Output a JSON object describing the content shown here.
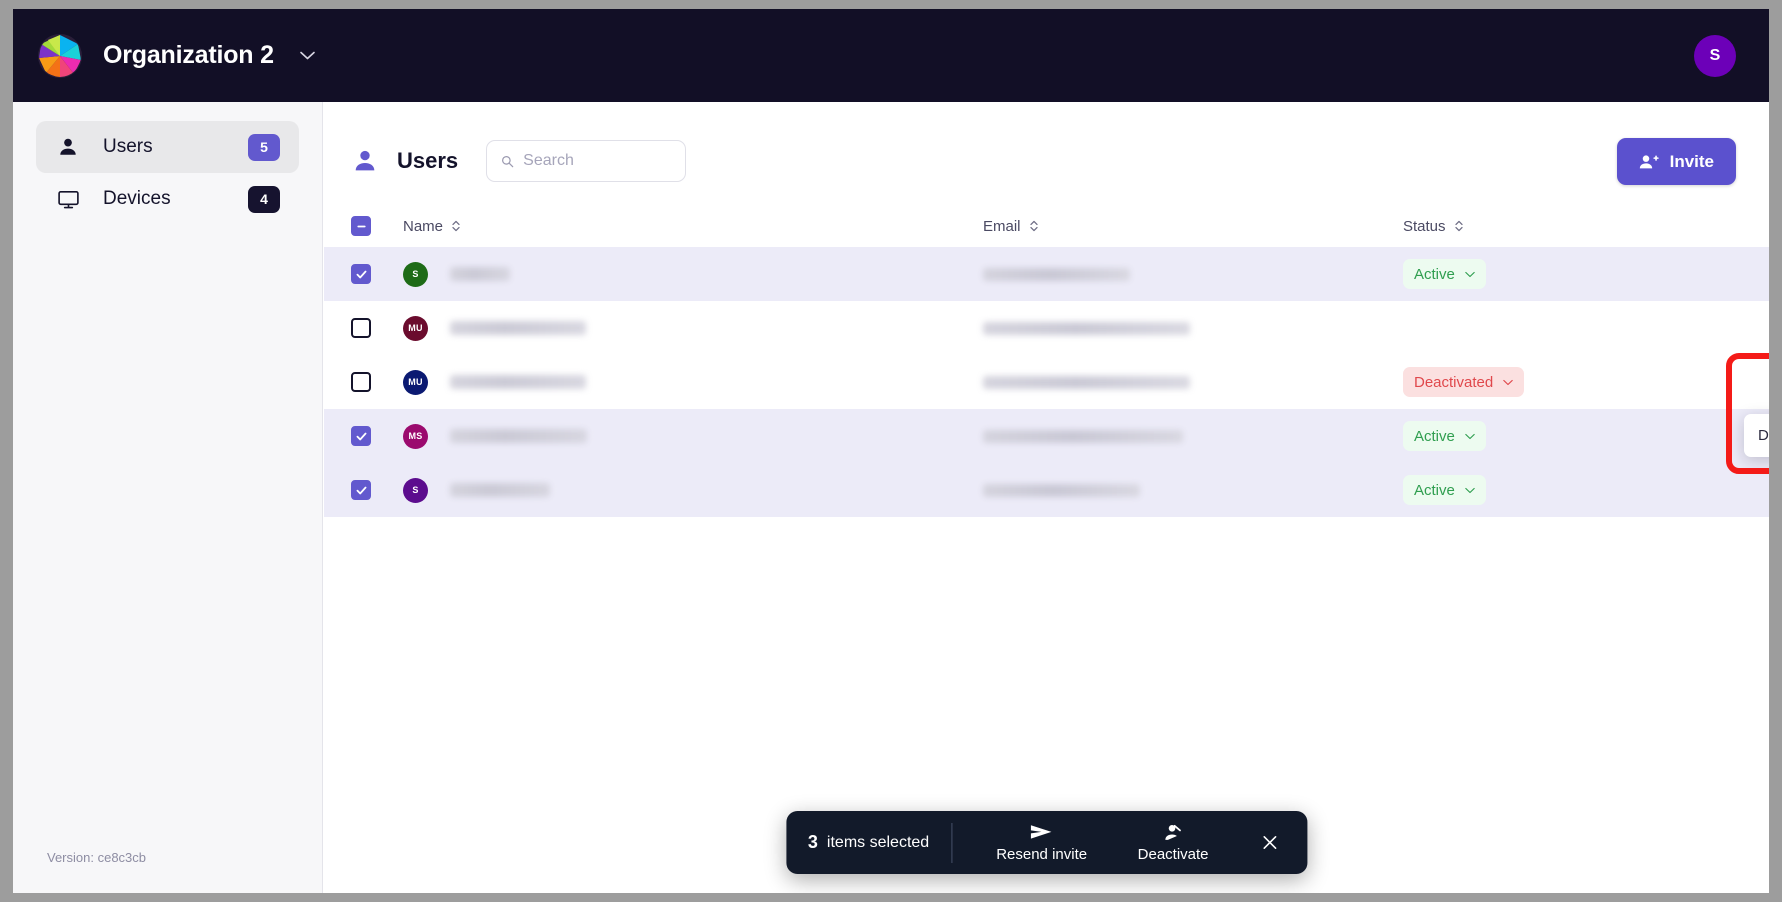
{
  "topbar": {
    "org_name": "Organization 2",
    "org_caret_icon": "chevron-down-icon",
    "logo_icon": "org-logo-icon",
    "user_avatar_initial": "S",
    "user_avatar_color": "#6c00b8"
  },
  "sidebar": {
    "items": [
      {
        "label": "Users",
        "badge": "5",
        "icon": "person-icon",
        "badge_color": "#6259ce",
        "active": true
      },
      {
        "label": "Devices",
        "badge": "4",
        "icon": "monitor-icon",
        "badge_color": "#16132f",
        "active": false
      }
    ],
    "version": "Version: ce8c3cb"
  },
  "main": {
    "page_title": "Users",
    "page_title_icon": "person-icon",
    "search": {
      "placeholder": "Search",
      "value": "",
      "icon": "search-icon"
    },
    "invite_button": {
      "label": "Invite",
      "icon": "person-add-icon",
      "color": "#5b51ce"
    }
  },
  "table": {
    "select_all_state": "indeterminate",
    "columns": [
      {
        "key": "name",
        "label": "Name",
        "sortable": true
      },
      {
        "key": "email",
        "label": "Email",
        "sortable": true
      },
      {
        "key": "status",
        "label": "Status",
        "sortable": true
      }
    ],
    "rows": [
      {
        "selected": true,
        "avatar_initials": "S",
        "avatar_color": "#1e6b17",
        "name_redacted": true,
        "name_width": 60,
        "email_redacted": true,
        "email_width": 147,
        "status": "Active",
        "status_kind": "active"
      },
      {
        "selected": false,
        "avatar_initials": "MU",
        "avatar_color": "#6b0c2e",
        "name_redacted": true,
        "name_width": 136,
        "email_redacted": true,
        "email_width": 207,
        "status": "",
        "status_kind": "none"
      },
      {
        "selected": false,
        "avatar_initials": "MU",
        "avatar_color": "#0b1a72",
        "name_redacted": true,
        "name_width": 136,
        "email_redacted": true,
        "email_width": 207,
        "status": "Deactivated",
        "status_kind": "deactivated"
      },
      {
        "selected": true,
        "avatar_initials": "MS",
        "avatar_color": "#9b0a6e",
        "name_redacted": true,
        "name_width": 137,
        "email_redacted": true,
        "email_width": 200,
        "status": "Active",
        "status_kind": "active"
      },
      {
        "selected": true,
        "avatar_initials": "S",
        "avatar_color": "#5c0c8e",
        "name_redacted": true,
        "name_width": 100,
        "email_redacted": true,
        "email_width": 157,
        "status": "Active",
        "status_kind": "active"
      }
    ]
  },
  "status_dropdown": {
    "open": true,
    "items": [
      {
        "label": "Deactivate user"
      }
    ]
  },
  "highlight": {
    "color": "#f41b18"
  },
  "action_bar": {
    "count": "3",
    "count_label": "items selected",
    "actions": [
      {
        "label": "Resend invite",
        "icon": "send-icon"
      },
      {
        "label": "Deactivate",
        "icon": "person-off-icon"
      }
    ],
    "close_icon": "close-icon"
  }
}
